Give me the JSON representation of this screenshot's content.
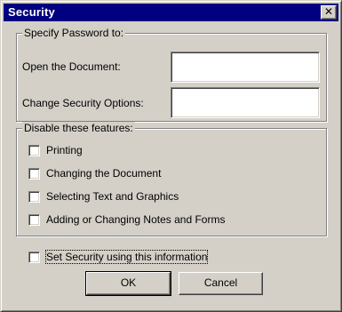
{
  "window": {
    "title": "Security",
    "close_glyph": "✕"
  },
  "password_group": {
    "legend": "Specify Password to:",
    "open_label": "Open the Document:",
    "open_value": "",
    "change_label": "Change Security Options:",
    "change_value": ""
  },
  "disable_group": {
    "legend": "Disable these features:",
    "items": [
      {
        "label": "Printing",
        "checked": false
      },
      {
        "label": "Changing the Document",
        "checked": false
      },
      {
        "label": "Selecting Text and Graphics",
        "checked": false
      },
      {
        "label": "Adding or Changing Notes and Forms",
        "checked": false
      }
    ]
  },
  "set_security": {
    "label": "Set Security using this information",
    "checked": false
  },
  "buttons": {
    "ok": "OK",
    "cancel": "Cancel"
  }
}
